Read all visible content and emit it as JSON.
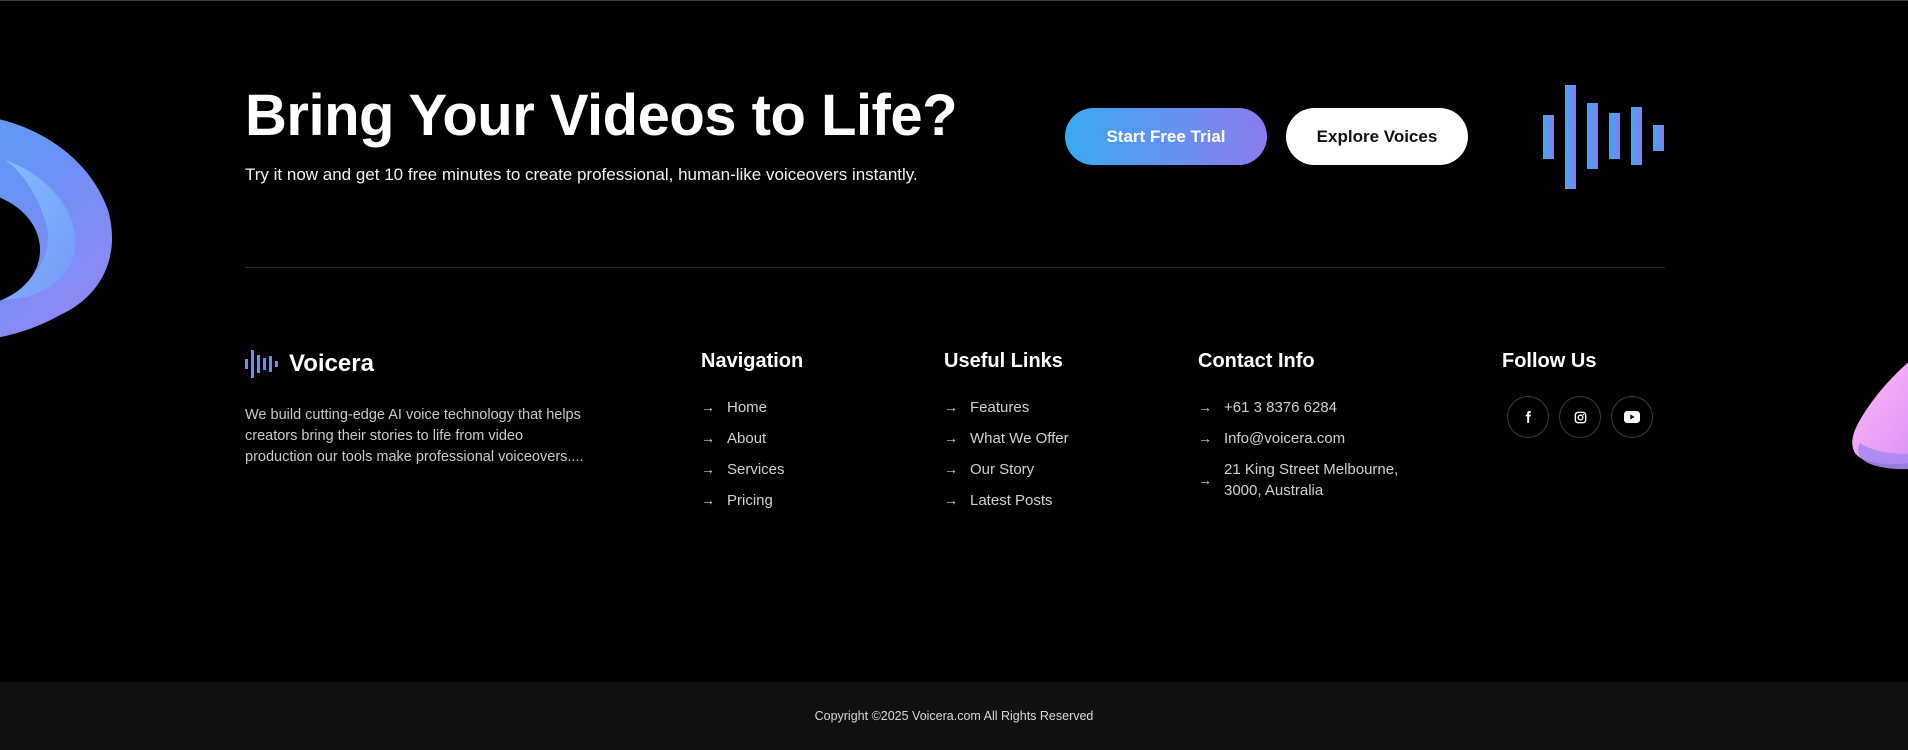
{
  "cta": {
    "title": "Bring Your Videos to Life?",
    "subtitle": "Try it now and get 10 free minutes to create professional, human-like voiceovers instantly.",
    "primary_button": "Start Free Trial",
    "secondary_button": "Explore Voices"
  },
  "brand": {
    "name": "Voicera",
    "description": "We build cutting-edge AI voice technology that helps creators bring their stories to life from video production our tools make professional voiceovers...."
  },
  "navigation": {
    "title": "Navigation",
    "items": [
      {
        "label": "Home"
      },
      {
        "label": "About"
      },
      {
        "label": "Services"
      },
      {
        "label": "Pricing"
      }
    ]
  },
  "useful_links": {
    "title": "Useful Links",
    "items": [
      {
        "label": "Features"
      },
      {
        "label": "What We Offer"
      },
      {
        "label": "Our Story"
      },
      {
        "label": "Latest Posts"
      }
    ]
  },
  "contact": {
    "title": "Contact Info",
    "phone": "+61 3 8376 6284",
    "email": "Info@voicera.com",
    "address_line1": "21 King Street Melbourne,",
    "address_line2": "3000, Australia"
  },
  "follow": {
    "title": "Follow Us",
    "icons": [
      "facebook-icon",
      "instagram-icon",
      "youtube-icon"
    ]
  },
  "footer": {
    "copyright": "Copyright ©2025 Voicera.com All Rights Reserved"
  },
  "colors": {
    "background": "#000000",
    "gradient_start": "#3aa9f3",
    "gradient_end": "#8a7cf0",
    "bottom_bar": "#101010"
  }
}
